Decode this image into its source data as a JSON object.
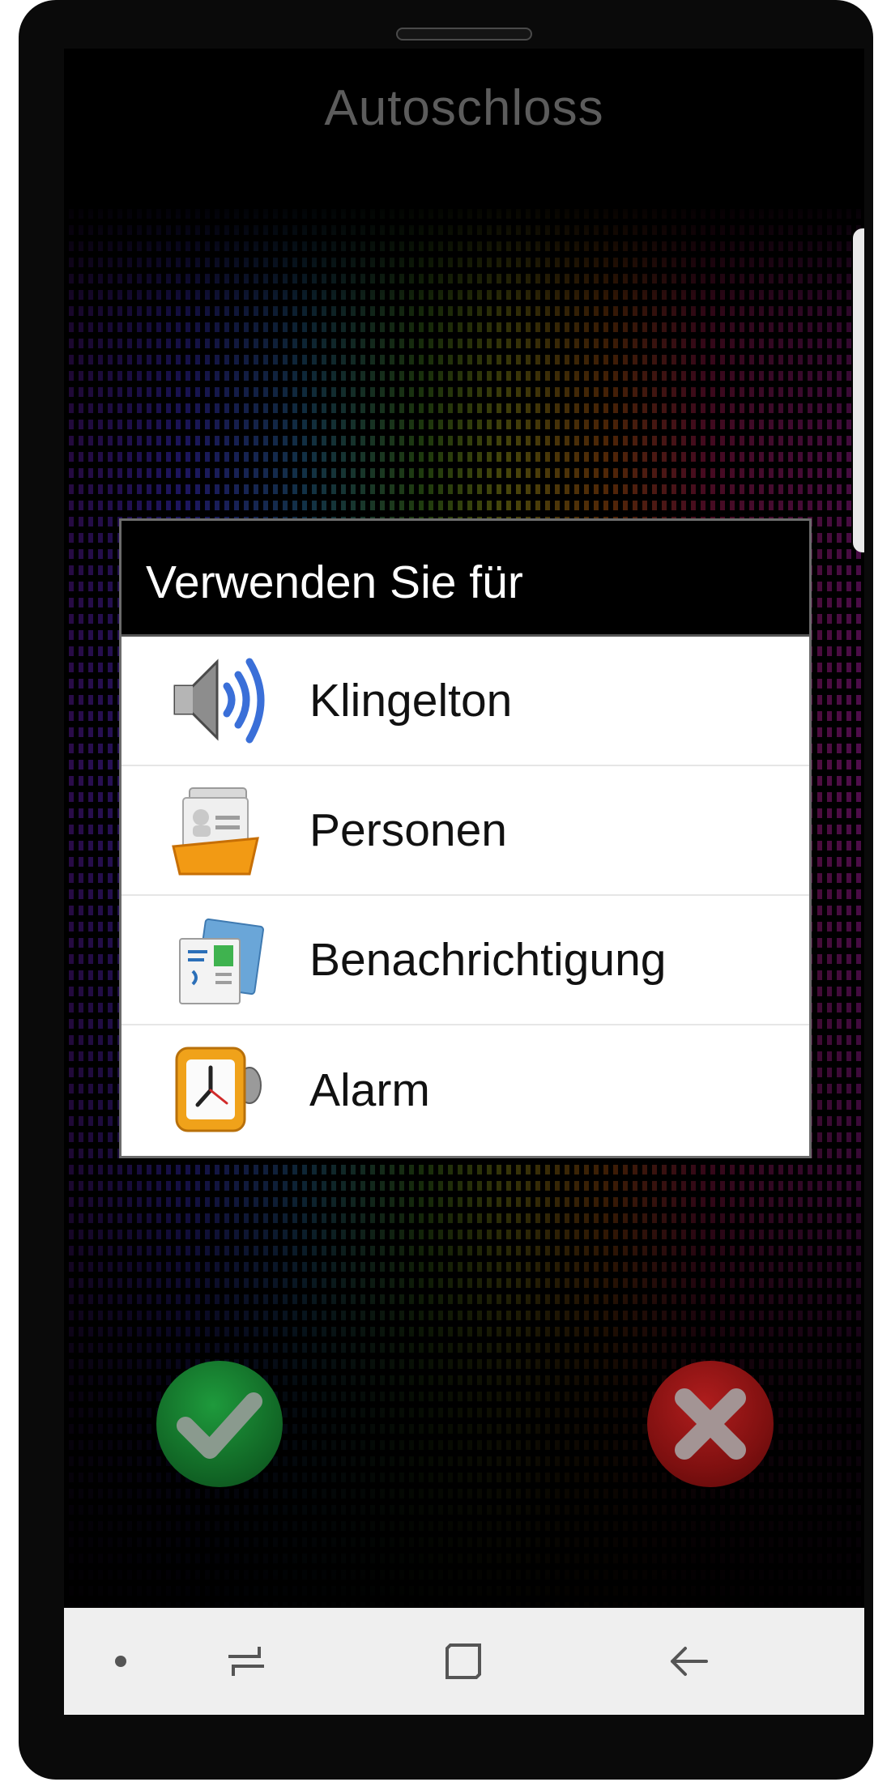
{
  "app": {
    "title": "Autoschloss"
  },
  "dialog": {
    "title": "Verwenden Sie für",
    "options": [
      {
        "label": "Klingelton",
        "icon": "speaker-icon"
      },
      {
        "label": "Personen",
        "icon": "contacts-folder-icon"
      },
      {
        "label": "Benachrichtigung",
        "icon": "notification-icon"
      },
      {
        "label": "Alarm",
        "icon": "alarm-clock-icon"
      }
    ]
  },
  "actions": {
    "confirm_icon": "checkmark-icon",
    "cancel_icon": "close-icon",
    "confirm_color": "#177f32",
    "cancel_color": "#931515"
  },
  "navbar": {
    "items": [
      "dot-icon",
      "recent-apps-icon",
      "home-icon",
      "back-icon"
    ]
  }
}
